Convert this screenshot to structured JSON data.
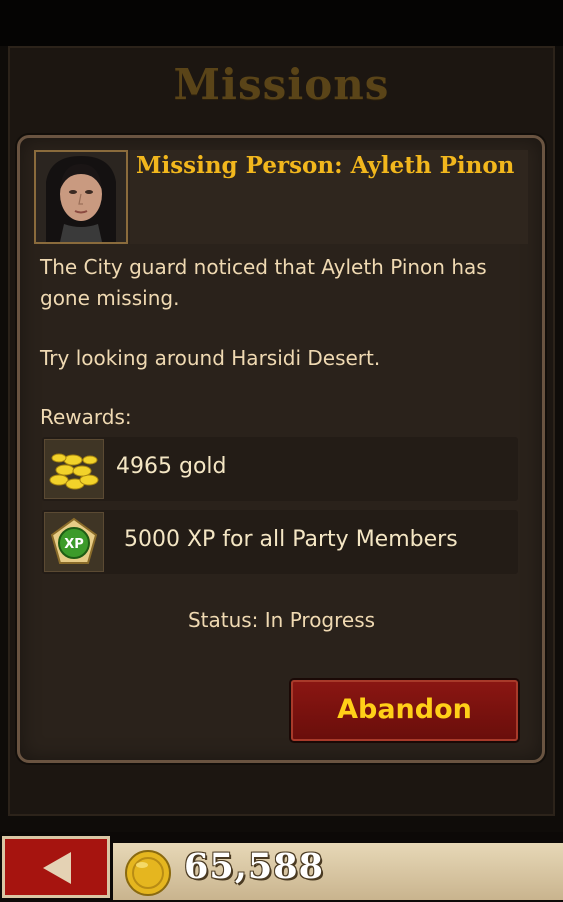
{
  "header": {
    "title": "Missions"
  },
  "mission": {
    "title": "Missing Person: Ayleth Pinon",
    "description_line1": "The City guard noticed that Ayleth Pinon has",
    "description_line2": "gone missing.",
    "hint": "Try looking around Harsidi Desert.",
    "rewards_label": "Rewards:",
    "rewards": [
      {
        "icon": "gold-coins-icon",
        "text": "4965 gold"
      },
      {
        "icon": "xp-badge-icon",
        "text": "5000 XP for all Party Members",
        "badge": "XP"
      }
    ],
    "status": "Status: In Progress",
    "abandon_label": "Abandon"
  },
  "footer": {
    "back_icon": "back-arrow-icon",
    "gold_amount": "65,588",
    "coin_icon": "gold-coin-icon"
  },
  "colors": {
    "title": "#f2b71d",
    "button": "#8a1612",
    "button_text": "#ffd018",
    "body_text": "#efd9b2"
  }
}
